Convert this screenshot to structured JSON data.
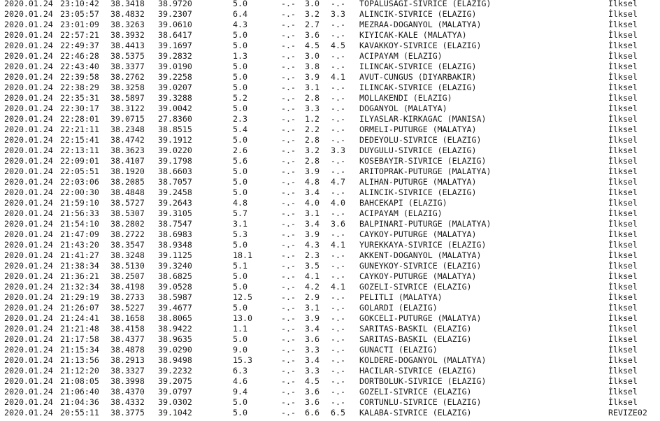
{
  "events": [
    {
      "date": "2020.01.24",
      "time": "23:10:42",
      "lat": "38.3418",
      "lon": "38.9720",
      "depth": "5.0",
      "md": "-.-",
      "ml": "3.0",
      "mw": "-.-",
      "place": "TOPALUSAGI-SIVRICE (ELAZIG)",
      "solution": "İlksel"
    },
    {
      "date": "2020.01.24",
      "time": "23:05:57",
      "lat": "38.4832",
      "lon": "39.2307",
      "depth": "6.4",
      "md": "-.-",
      "ml": "3.2",
      "mw": "3.3",
      "place": "ALINCIK-SIVRICE (ELAZIG)",
      "solution": "İlksel"
    },
    {
      "date": "2020.01.24",
      "time": "23:01:09",
      "lat": "38.3263",
      "lon": "39.0610",
      "depth": "4.3",
      "md": "-.-",
      "ml": "2.7",
      "mw": "-.-",
      "place": "MEZRAA-DOGANYOL (MALATYA)",
      "solution": "İlksel"
    },
    {
      "date": "2020.01.24",
      "time": "22:57:21",
      "lat": "38.3932",
      "lon": "38.6417",
      "depth": "5.0",
      "md": "-.-",
      "ml": "3.6",
      "mw": "-.-",
      "place": "KIYICAK-KALE (MALATYA)",
      "solution": "İlksel"
    },
    {
      "date": "2020.01.24",
      "time": "22:49:37",
      "lat": "38.4413",
      "lon": "39.1697",
      "depth": "5.0",
      "md": "-.-",
      "ml": "4.5",
      "mw": "4.5",
      "place": "KAVAKKOY-SIVRICE (ELAZIG)",
      "solution": "İlksel"
    },
    {
      "date": "2020.01.24",
      "time": "22:46:28",
      "lat": "38.5375",
      "lon": "39.2832",
      "depth": "1.3",
      "md": "-.-",
      "ml": "3.0",
      "mw": "-.-",
      "place": "ACIPAYAM (ELAZIG)",
      "solution": "İlksel"
    },
    {
      "date": "2020.01.24",
      "time": "22:43:40",
      "lat": "38.3377",
      "lon": "39.0190",
      "depth": "5.0",
      "md": "-.-",
      "ml": "3.8",
      "mw": "-.-",
      "place": "ILINCAK-SIVRICE (ELAZIG)",
      "solution": "İlksel"
    },
    {
      "date": "2020.01.24",
      "time": "22:39:58",
      "lat": "38.2762",
      "lon": "39.2258",
      "depth": "5.0",
      "md": "-.-",
      "ml": "3.9",
      "mw": "4.1",
      "place": "AVUT-CUNGUS (DIYARBAKIR)",
      "solution": "İlksel"
    },
    {
      "date": "2020.01.24",
      "time": "22:38:29",
      "lat": "38.3258",
      "lon": "39.0207",
      "depth": "5.0",
      "md": "-.-",
      "ml": "3.1",
      "mw": "-.-",
      "place": "ILINCAK-SIVRICE (ELAZIG)",
      "solution": "İlksel"
    },
    {
      "date": "2020.01.24",
      "time": "22:35:31",
      "lat": "38.5897",
      "lon": "39.3288",
      "depth": "5.2",
      "md": "-.-",
      "ml": "2.8",
      "mw": "-.-",
      "place": "MOLLAKENDI (ELAZIG)",
      "solution": "İlksel"
    },
    {
      "date": "2020.01.24",
      "time": "22:30:17",
      "lat": "38.3122",
      "lon": "39.0042",
      "depth": "5.0",
      "md": "-.-",
      "ml": "3.3",
      "mw": "-.-",
      "place": "DOGANYOL (MALATYA)",
      "solution": "İlksel"
    },
    {
      "date": "2020.01.24",
      "time": "22:28:01",
      "lat": "39.0715",
      "lon": "27.8360",
      "depth": "2.3",
      "md": "-.-",
      "ml": "1.2",
      "mw": "-.-",
      "place": "ILYASLAR-KIRKAGAC (MANISA)",
      "solution": "İlksel"
    },
    {
      "date": "2020.01.24",
      "time": "22:21:11",
      "lat": "38.2348",
      "lon": "38.8515",
      "depth": "5.4",
      "md": "-.-",
      "ml": "2.2",
      "mw": "-.-",
      "place": "ORMELI-PUTURGE (MALATYA)",
      "solution": "İlksel"
    },
    {
      "date": "2020.01.24",
      "time": "22:15:41",
      "lat": "38.4742",
      "lon": "39.1912",
      "depth": "5.0",
      "md": "-.-",
      "ml": "2.8",
      "mw": "-.-",
      "place": "DEDEYOLU-SIVRICE (ELAZIG)",
      "solution": "İlksel"
    },
    {
      "date": "2020.01.24",
      "time": "22:13:11",
      "lat": "38.3623",
      "lon": "39.0220",
      "depth": "2.6",
      "md": "-.-",
      "ml": "3.2",
      "mw": "3.3",
      "place": "DUYGULU-SIVRICE (ELAZIG)",
      "solution": "İlksel"
    },
    {
      "date": "2020.01.24",
      "time": "22:09:01",
      "lat": "38.4107",
      "lon": "39.1798",
      "depth": "5.6",
      "md": "-.-",
      "ml": "2.8",
      "mw": "-.-",
      "place": "KOSEBAYIR-SIVRICE (ELAZIG)",
      "solution": "İlksel"
    },
    {
      "date": "2020.01.24",
      "time": "22:05:51",
      "lat": "38.1920",
      "lon": "38.6603",
      "depth": "5.0",
      "md": "-.-",
      "ml": "3.9",
      "mw": "-.-",
      "place": "ARITOPRAK-PUTURGE (MALATYA)",
      "solution": "İlksel"
    },
    {
      "date": "2020.01.24",
      "time": "22:03:06",
      "lat": "38.2085",
      "lon": "38.7057",
      "depth": "5.0",
      "md": "-.-",
      "ml": "4.8",
      "mw": "4.7",
      "place": "ALIHAN-PUTURGE (MALATYA)",
      "solution": "İlksel"
    },
    {
      "date": "2020.01.24",
      "time": "22:00:30",
      "lat": "38.4848",
      "lon": "39.2458",
      "depth": "5.0",
      "md": "-.-",
      "ml": "3.4",
      "mw": "-.-",
      "place": "ALINCIK-SIVRICE (ELAZIG)",
      "solution": "İlksel"
    },
    {
      "date": "2020.01.24",
      "time": "21:59:10",
      "lat": "38.5727",
      "lon": "39.2643",
      "depth": "4.8",
      "md": "-.-",
      "ml": "4.0",
      "mw": "4.0",
      "place": "BAHCEKAPI (ELAZIG)",
      "solution": "İlksel"
    },
    {
      "date": "2020.01.24",
      "time": "21:56:33",
      "lat": "38.5307",
      "lon": "39.3105",
      "depth": "5.7",
      "md": "-.-",
      "ml": "3.1",
      "mw": "-.-",
      "place": "ACIPAYAM (ELAZIG)",
      "solution": "İlksel"
    },
    {
      "date": "2020.01.24",
      "time": "21:54:10",
      "lat": "38.2802",
      "lon": "38.7547",
      "depth": "3.1",
      "md": "-.-",
      "ml": "3.4",
      "mw": "3.6",
      "place": "BALPINARI-PUTURGE (MALATYA)",
      "solution": "İlksel"
    },
    {
      "date": "2020.01.24",
      "time": "21:47:09",
      "lat": "38.2722",
      "lon": "38.6983",
      "depth": "5.3",
      "md": "-.-",
      "ml": "3.9",
      "mw": "-.-",
      "place": "CAYKOY-PUTURGE (MALATYA)",
      "solution": "İlksel"
    },
    {
      "date": "2020.01.24",
      "time": "21:43:20",
      "lat": "38.3547",
      "lon": "38.9348",
      "depth": "5.0",
      "md": "-.-",
      "ml": "4.3",
      "mw": "4.1",
      "place": "YUREKKAYA-SIVRICE (ELAZIG)",
      "solution": "İlksel"
    },
    {
      "date": "2020.01.24",
      "time": "21:41:27",
      "lat": "38.3248",
      "lon": "39.1125",
      "depth": "18.1",
      "md": "-.-",
      "ml": "2.3",
      "mw": "-.-",
      "place": "AKKENT-DOGANYOL (MALATYA)",
      "solution": "İlksel"
    },
    {
      "date": "2020.01.24",
      "time": "21:38:34",
      "lat": "38.5130",
      "lon": "39.3240",
      "depth": "5.1",
      "md": "-.-",
      "ml": "3.5",
      "mw": "-.-",
      "place": "GUNEYKOY-SIVRICE (ELAZIG)",
      "solution": "İlksel"
    },
    {
      "date": "2020.01.24",
      "time": "21:36:21",
      "lat": "38.2507",
      "lon": "38.6825",
      "depth": "5.0",
      "md": "-.-",
      "ml": "4.1",
      "mw": "-.-",
      "place": "CAYKOY-PUTURGE (MALATYA)",
      "solution": "İlksel"
    },
    {
      "date": "2020.01.24",
      "time": "21:32:34",
      "lat": "38.4198",
      "lon": "39.0528",
      "depth": "5.0",
      "md": "-.-",
      "ml": "4.2",
      "mw": "4.1",
      "place": "GOZELI-SIVRICE (ELAZIG)",
      "solution": "İlksel"
    },
    {
      "date": "2020.01.24",
      "time": "21:29:19",
      "lat": "38.2733",
      "lon": "38.5987",
      "depth": "12.5",
      "md": "-.-",
      "ml": "2.9",
      "mw": "-.-",
      "place": "PELITLI (MALATYA)",
      "solution": "İlksel"
    },
    {
      "date": "2020.01.24",
      "time": "21:26:07",
      "lat": "38.5227",
      "lon": "39.4677",
      "depth": "5.0",
      "md": "-.-",
      "ml": "3.1",
      "mw": "-.-",
      "place": "GOLARDI (ELAZIG)",
      "solution": "İlksel"
    },
    {
      "date": "2020.01.24",
      "time": "21:24:41",
      "lat": "38.1658",
      "lon": "38.8065",
      "depth": "13.0",
      "md": "-.-",
      "ml": "3.9",
      "mw": "-.-",
      "place": "GOKCELI-PUTURGE (MALATYA)",
      "solution": "İlksel"
    },
    {
      "date": "2020.01.24",
      "time": "21:21:48",
      "lat": "38.4158",
      "lon": "38.9422",
      "depth": "1.1",
      "md": "-.-",
      "ml": "3.4",
      "mw": "-.-",
      "place": "SARITAS-BASKIL (ELAZIG)",
      "solution": "İlksel"
    },
    {
      "date": "2020.01.24",
      "time": "21:17:58",
      "lat": "38.4377",
      "lon": "38.9635",
      "depth": "5.0",
      "md": "-.-",
      "ml": "3.6",
      "mw": "-.-",
      "place": "SARITAS-BASKIL (ELAZIG)",
      "solution": "İlksel"
    },
    {
      "date": "2020.01.24",
      "time": "21:15:34",
      "lat": "38.4878",
      "lon": "39.0290",
      "depth": "9.0",
      "md": "-.-",
      "ml": "3.3",
      "mw": "-.-",
      "place": "GUNACTI (ELAZIG)",
      "solution": "İlksel"
    },
    {
      "date": "2020.01.24",
      "time": "21:13:56",
      "lat": "38.2913",
      "lon": "38.9498",
      "depth": "15.3",
      "md": "-.-",
      "ml": "3.4",
      "mw": "-.-",
      "place": "KOLDERE-DOGANYOL (MALATYA)",
      "solution": "İlksel"
    },
    {
      "date": "2020.01.24",
      "time": "21:12:20",
      "lat": "38.3327",
      "lon": "39.2232",
      "depth": "6.3",
      "md": "-.-",
      "ml": "3.3",
      "mw": "-.-",
      "place": "HACILAR-SIVRICE (ELAZIG)",
      "solution": "İlksel"
    },
    {
      "date": "2020.01.24",
      "time": "21:08:05",
      "lat": "38.3998",
      "lon": "39.2075",
      "depth": "4.6",
      "md": "-.-",
      "ml": "4.5",
      "mw": "-.-",
      "place": "DORTBOLUK-SIVRICE (ELAZIG)",
      "solution": "İlksel"
    },
    {
      "date": "2020.01.24",
      "time": "21:06:40",
      "lat": "38.4370",
      "lon": "39.0797",
      "depth": "9.4",
      "md": "-.-",
      "ml": "3.6",
      "mw": "-.-",
      "place": "GOZELI-SIVRICE (ELAZIG)",
      "solution": "İlksel"
    },
    {
      "date": "2020.01.24",
      "time": "21:04:36",
      "lat": "38.4332",
      "lon": "39.0302",
      "depth": "5.0",
      "md": "-.-",
      "ml": "3.6",
      "mw": "-.-",
      "place": "CORTUNLU-SIVRICE (ELAZIG)",
      "solution": "İlksel"
    },
    {
      "date": "2020.01.24",
      "time": "20:55:11",
      "lat": "38.3775",
      "lon": "39.1042",
      "depth": "5.0",
      "md": "-.-",
      "ml": "6.6",
      "mw": "6.5",
      "place": "KALABA-SIVRICE (ELAZIG)",
      "solution": "REVIZE02"
    }
  ]
}
